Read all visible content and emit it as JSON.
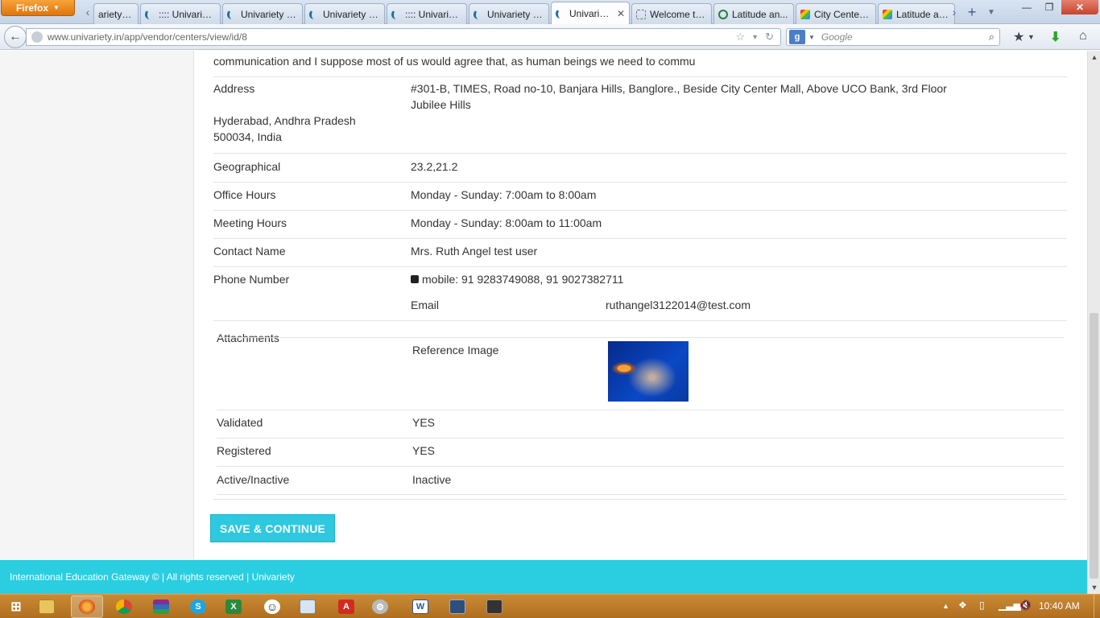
{
  "browser": {
    "menu_label": "Firefox",
    "tabs": [
      {
        "title": "ariety - ...",
        "icon": "univariety-icon",
        "active": false
      },
      {
        "title": ":::: Univariet...",
        "icon": "univariety-icon",
        "active": false
      },
      {
        "title": "Univariety - ...",
        "icon": "univariety-icon",
        "active": false
      },
      {
        "title": "Univariety ::...",
        "icon": "univariety-icon",
        "active": false
      },
      {
        "title": ":::: Univariet...",
        "icon": "univariety-icon",
        "active": false
      },
      {
        "title": "Univariety ::...",
        "icon": "univariety-icon",
        "active": false
      },
      {
        "title": "Univariet...",
        "icon": "univariety-icon",
        "active": true
      },
      {
        "title": "Welcome to...",
        "icon": "dotted-page-icon",
        "active": false
      },
      {
        "title": "Latitude an...",
        "icon": "globe-icon",
        "active": false
      },
      {
        "title": "City Center ...",
        "icon": "maps-icon",
        "active": false
      },
      {
        "title": "Latitude an...",
        "icon": "maps-icon",
        "active": false
      }
    ],
    "url": "www.univariety.in/app/vendor/centers/view/id/8",
    "search_placeholder": "Google"
  },
  "page": {
    "description_tail": "communication and I suppose most of us would agree that, as human beings we need to commu",
    "address": {
      "label": "Address",
      "line1": "#301-B, TIMES, Road no-10, Banjara Hills, Banglore., Beside City Center Mall, Above UCO Bank, 3rd Floor",
      "line2": "Jubilee Hills",
      "city_state": "Hyderabad, Andhra Pradesh",
      "zip_country": "500034, India"
    },
    "geographical": {
      "label": "Geographical",
      "value": "23.2,21.2"
    },
    "office_hours": {
      "label": "Office Hours",
      "value": "Monday - Sunday: 7:00am to 8:00am"
    },
    "meeting_hours": {
      "label": "Meeting Hours",
      "value": "Monday - Sunday: 8:00am to 11:00am"
    },
    "contact_name": {
      "label": "Contact Name",
      "value": "Mrs. Ruth Angel test user"
    },
    "phone": {
      "label": "Phone Number",
      "value": "mobile: 91 9283749088, 91 9027382711"
    },
    "email": {
      "label": "Email",
      "value": "ruthangel3122014@test.com"
    },
    "attachments": {
      "label": "Attachments",
      "reference_label": "Reference Image",
      "image_icon": "jellyfish-image"
    },
    "validated": {
      "label": "Validated",
      "value": "YES"
    },
    "registered": {
      "label": "Registered",
      "value": "YES"
    },
    "active": {
      "label": "Active/Inactive",
      "value": "Inactive"
    },
    "save_button": "SAVE & CONTINUE",
    "footer": "International Education Gateway © | All rights reserved | Univariety"
  },
  "taskbar": {
    "clock": "10:40 AM",
    "apps": [
      "windows-start-icon",
      "file-explorer-icon",
      "firefox-icon",
      "chrome-icon",
      "winrar-icon",
      "skype-icon",
      "excel-icon",
      "smiley-icon",
      "window-app-icon",
      "adobe-reader-icon",
      "tools-icon",
      "word-icon",
      "monitor-app-icon",
      "media-app-icon"
    ]
  },
  "colors": {
    "accent": "#2ec8e0",
    "footer": "#2bcde0",
    "taskbar": "#b97a2a",
    "firefox_button": "#e8841a"
  }
}
